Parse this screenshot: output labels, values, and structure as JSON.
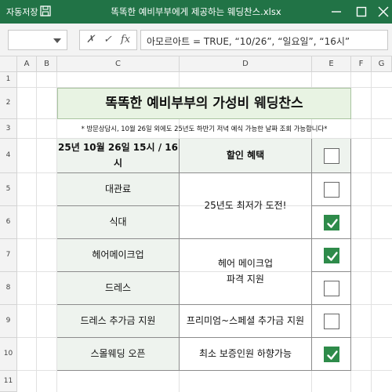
{
  "titlebar": {
    "autosave_label": "자동저장",
    "document_title": "똑똑한 예비부부에게 제공하는 웨딩찬스.xlsx"
  },
  "formula_bar": {
    "name_box": "",
    "cancel_symbol": "✗",
    "enter_symbol": "✓",
    "fx_symbol": "fx",
    "formula": "아모르아트 = TRUE, “10/26”, “일요일”, “16시”"
  },
  "columns": [
    "A",
    "B",
    "C",
    "D",
    "E",
    "F",
    "G"
  ],
  "rows": [
    "1",
    "2",
    "3",
    "4",
    "5",
    "6",
    "7",
    "8",
    "9",
    "10",
    "11"
  ],
  "sheet": {
    "banner_title": "똑똑한 예비부부의 가성비 웨딩찬스",
    "note": "* 방문상담시, 10월 26일 외에도 25년도 하반기 저녁 예식 가능한 날짜 조회 가능합니다*",
    "header_date": "25년 10월 26일 15시 / 16시",
    "header_benefit": "할인 혜택",
    "items": [
      "대관료",
      "식대",
      "헤어메이크업",
      "드레스",
      "드레스 추가금 지원",
      "스몰웨딩 오픈"
    ],
    "benefits": {
      "b1": "25년도 최저가 도전!",
      "b2_line1": "헤어 메이크업",
      "b2_line2": "파격 지원",
      "b3": "프리미엄~스페셜 추가금 지원",
      "b4": "최소 보증인원 하향가능"
    },
    "checkboxes": {
      "header": false,
      "rows": [
        false,
        true,
        true,
        false,
        false,
        true
      ]
    }
  },
  "colors": {
    "titlebar": "#217346",
    "banner_fill": "#e8f3e3",
    "cell_shade": "#eef3ee",
    "check_green": "#2e8b4a"
  }
}
